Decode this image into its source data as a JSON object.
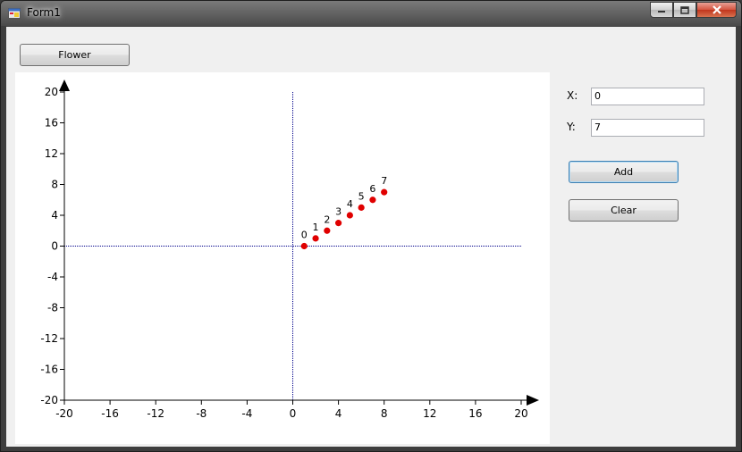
{
  "window": {
    "title": "Form1",
    "controls": [
      "minimize-icon",
      "maximize-icon",
      "close-icon"
    ]
  },
  "toolbar": {
    "flower_label": "Flower"
  },
  "inputs": {
    "x_label": "X:",
    "x_value": "0",
    "y_label": "Y:",
    "y_value": "7"
  },
  "buttons": {
    "add_label": "Add",
    "clear_label": "Clear"
  },
  "chart_data": {
    "type": "scatter",
    "xlim": [
      -20,
      20
    ],
    "ylim": [
      -20,
      20
    ],
    "x_ticks": [
      -20,
      -16,
      -12,
      -8,
      -4,
      0,
      4,
      8,
      12,
      16,
      20
    ],
    "y_ticks": [
      20,
      16,
      12,
      8,
      4,
      0,
      -4,
      -8,
      -12,
      -16,
      -20
    ],
    "points": [
      {
        "label": "0",
        "x": 1,
        "y": 0
      },
      {
        "label": "1",
        "x": 2,
        "y": 1
      },
      {
        "label": "2",
        "x": 3,
        "y": 2
      },
      {
        "label": "3",
        "x": 4,
        "y": 3
      },
      {
        "label": "4",
        "x": 5,
        "y": 4
      },
      {
        "label": "5",
        "x": 6,
        "y": 5
      },
      {
        "label": "6",
        "x": 7,
        "y": 6
      },
      {
        "label": "7",
        "x": 8,
        "y": 7
      }
    ],
    "point_color": "#e00000",
    "crosshair_color": "#00008b",
    "grid": false
  }
}
